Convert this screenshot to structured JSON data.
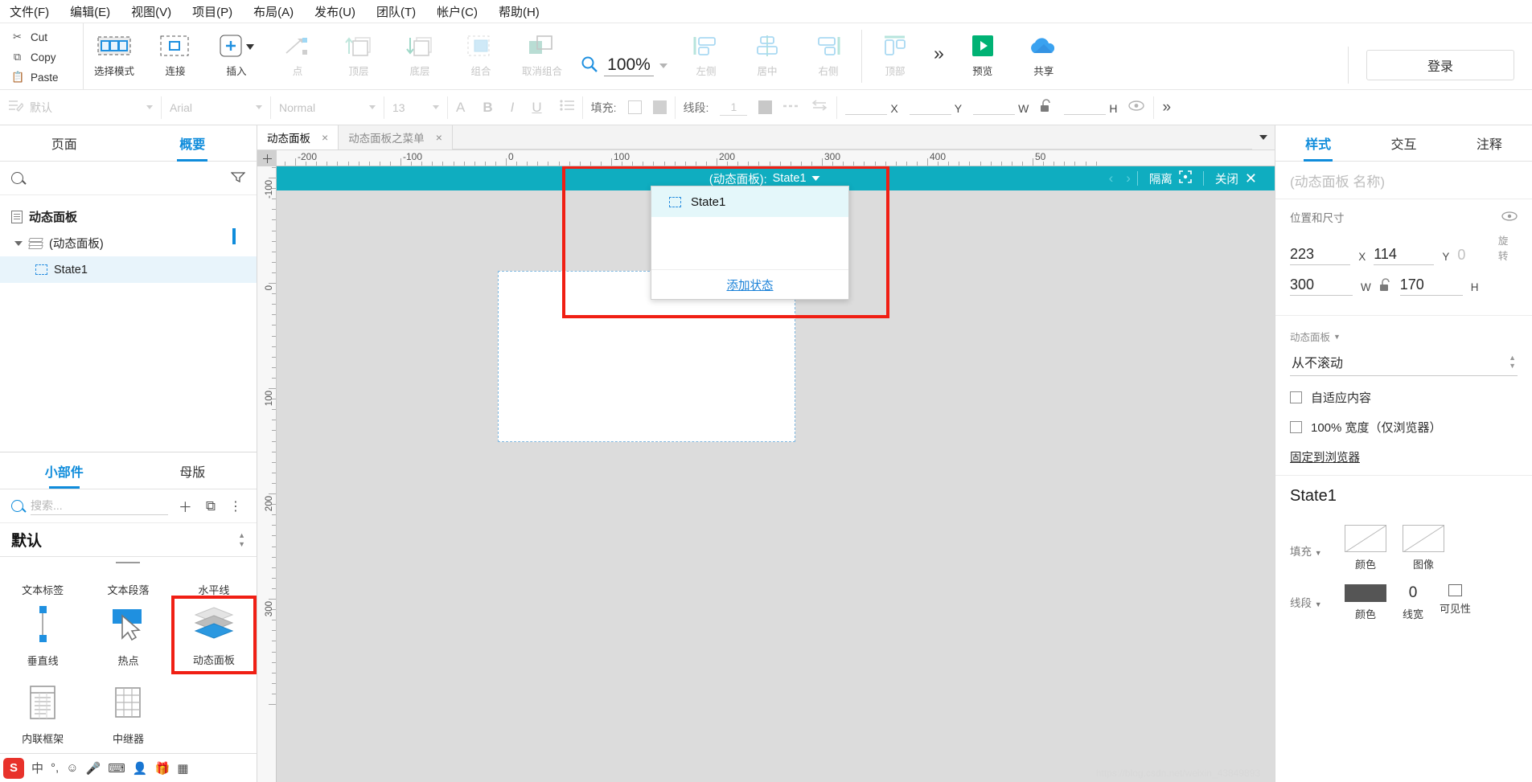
{
  "menubar": [
    {
      "label": "文件(F)"
    },
    {
      "label": "编辑(E)"
    },
    {
      "label": "视图(V)"
    },
    {
      "label": "项目(P)"
    },
    {
      "label": "布局(A)"
    },
    {
      "label": "发布(U)"
    },
    {
      "label": "团队(T)"
    },
    {
      "label": "帐户(C)"
    },
    {
      "label": "帮助(H)"
    }
  ],
  "clipboard": [
    {
      "label": "Cut",
      "icon": "scissors-icon"
    },
    {
      "label": "Copy",
      "icon": "copy-icon"
    },
    {
      "label": "Paste",
      "icon": "paste-icon"
    }
  ],
  "ribbon": {
    "group1": [
      {
        "label": "选择模式",
        "icon": "select-mode-icon",
        "dim": false
      },
      {
        "label": "连接",
        "icon": "connect-icon",
        "dim": false
      }
    ],
    "group2": [
      {
        "label": "插入",
        "icon": "insert-plus-icon",
        "dim": false
      },
      {
        "label": "点",
        "icon": "point-icon",
        "dim": true
      }
    ],
    "group3": [
      {
        "label": "顶层",
        "icon": "bring-to-front-icon",
        "dim": true
      },
      {
        "label": "底层",
        "icon": "send-to-back-icon",
        "dim": true
      },
      {
        "label": "组合",
        "icon": "group-icon",
        "dim": true
      },
      {
        "label": "取消组合",
        "icon": "ungroup-icon",
        "dim": true
      }
    ],
    "zoom": {
      "value": "100%",
      "icon": "zoom-search-icon"
    },
    "align": [
      {
        "label": "左侧",
        "icon": "align-left-icon",
        "dim": true
      },
      {
        "label": "居中",
        "icon": "align-center-icon",
        "dim": true
      },
      {
        "label": "右侧",
        "icon": "align-right-icon",
        "dim": true
      },
      {
        "label": "顶部",
        "icon": "align-top-icon",
        "dim": true
      }
    ],
    "more": "»",
    "actions": [
      {
        "label": "预览",
        "icon": "play-preview-icon"
      },
      {
        "label": "共享",
        "icon": "cloud-share-icon"
      }
    ],
    "login": "登录"
  },
  "formatbar": {
    "style_name": "默认",
    "font_family": "Arial",
    "font_weight": "Normal",
    "font_size": "13",
    "text_color_icon": "A",
    "bold": "B",
    "italic": "I",
    "underline": "U",
    "list": "list-icon",
    "fill_label": "填充:",
    "line_label": "线段:",
    "line_width": "1",
    "x_label": "X",
    "y_label": "Y",
    "w_label": "W",
    "h_label": "H",
    "lock_icon": "unlock-icon",
    "eye_icon": "eye-icon",
    "more": "»"
  },
  "left_panel": {
    "tabs": [
      {
        "label": "页面",
        "active": false
      },
      {
        "label": "概要",
        "active": true
      }
    ],
    "search_placeholder": "",
    "filter_icon": "filter-icon",
    "tree": [
      {
        "label": "动态面板",
        "icon": "document-icon",
        "bold": true,
        "selected": false,
        "indent": 0
      },
      {
        "label": "(动态面板)",
        "icon": "layers-icon",
        "bold": false,
        "selected": false,
        "indent": 1,
        "expanded": true
      },
      {
        "label": "State1",
        "icon": "dashed-square-icon",
        "bold": false,
        "selected": true,
        "indent": 2
      }
    ],
    "widgets": {
      "tabs": [
        {
          "label": "小部件",
          "active": true
        },
        {
          "label": "母版",
          "active": false
        }
      ],
      "search_placeholder": "搜索...",
      "add_icon": "plus-icon",
      "duplicate_icon": "copy-library-icon",
      "more_icon": "more-vertical-icon",
      "library_name": "默认",
      "row1": [
        {
          "label": "文本标签"
        },
        {
          "label": "文本段落"
        },
        {
          "label": "水平线"
        }
      ],
      "row2": [
        {
          "label": "垂直线",
          "icon": "vertical-line-icon",
          "highlight": false
        },
        {
          "label": "热点",
          "icon": "hotspot-icon",
          "highlight": false
        },
        {
          "label": "动态面板",
          "icon": "dynamic-panel-icon",
          "highlight": true
        }
      ],
      "row3": [
        {
          "label": "内联框架",
          "icon": "iframe-icon",
          "highlight": false
        },
        {
          "label": "中继器",
          "icon": "repeater-icon",
          "highlight": false
        }
      ]
    }
  },
  "canvas": {
    "tabs": [
      {
        "label": "动态面板",
        "active": true,
        "close": "×"
      },
      {
        "label": "动态面板之菜单",
        "active": false,
        "close": "×"
      }
    ],
    "h_ruler_labels": [
      "-200",
      "-100",
      "0",
      "100",
      "200",
      "300",
      "400",
      "50"
    ],
    "v_ruler_labels": [
      "-100",
      "0",
      "100",
      "200",
      "300"
    ],
    "dynamic_panel_bar": {
      "prefix": "(动态面板):",
      "state": "State1",
      "isolate": "隔离",
      "isolate_icon": "isolate-icon",
      "close": "关闭",
      "close_icon": "close-x-icon",
      "prev_icon": "chevron-left-icon",
      "next_icon": "chevron-right-icon"
    },
    "state_menu": {
      "items": [
        {
          "label": "State1",
          "selected": true
        }
      ],
      "add_link": "添加状态"
    },
    "watermark": "https://blog.csdn.net/weixin_43849893"
  },
  "right_panel": {
    "tabs": [
      {
        "label": "样式",
        "active": true
      },
      {
        "label": "交互",
        "active": false
      },
      {
        "label": "注释",
        "active": false
      }
    ],
    "name_placeholder": "(动态面板 名称)",
    "position_section": {
      "title": "位置和尺寸",
      "eye_icon": "eye-icon",
      "x": "223",
      "x_label": "X",
      "y": "114",
      "y_label": "Y",
      "rotation": "0",
      "rotation_label": "旋转",
      "w": "300",
      "w_label": "W",
      "h": "170",
      "h_label": "H",
      "lock_icon": "unlock-icon"
    },
    "panel_section": {
      "title": "动态面板",
      "scroll_value": "从不滚动",
      "checkboxes": [
        {
          "label": "自适应内容",
          "checked": false
        },
        {
          "label": "100% 宽度（仅浏览器）",
          "checked": false
        }
      ],
      "pin_link": "固定到浏览器"
    },
    "state_title": "State1",
    "fill": {
      "label": "填充",
      "options": [
        {
          "label": "颜色",
          "icon": "fill-color-icon"
        },
        {
          "label": "图像",
          "icon": "fill-image-icon"
        }
      ]
    },
    "stroke": {
      "label": "线段",
      "color_label": "颜色",
      "width_value": "0",
      "width_label": "线宽",
      "visible_label": "可见性",
      "visible_icon": "eye-icon"
    }
  },
  "taskbar": {
    "items": [
      {
        "icon": "sogou-logo-icon",
        "label": "S"
      },
      {
        "icon": "ime-chinese-icon",
        "label": "中"
      },
      {
        "icon": "ime-punct-icon",
        "label": "°,"
      },
      {
        "icon": "emoji-icon",
        "label": "☺"
      },
      {
        "icon": "mic-icon",
        "label": "🎤"
      },
      {
        "icon": "keyboard-icon",
        "label": "⌨"
      },
      {
        "icon": "user-icon",
        "label": "👤"
      },
      {
        "icon": "gift-icon",
        "label": "🎁"
      },
      {
        "icon": "apps-icon",
        "label": "▦"
      }
    ]
  },
  "colors": {
    "accent_blue": "#0f8cdb",
    "teal_bar": "#0fadc0",
    "red_highlight": "#f01f14",
    "green_preview": "#00b274",
    "cloud_blue": "#3aa2f0"
  }
}
